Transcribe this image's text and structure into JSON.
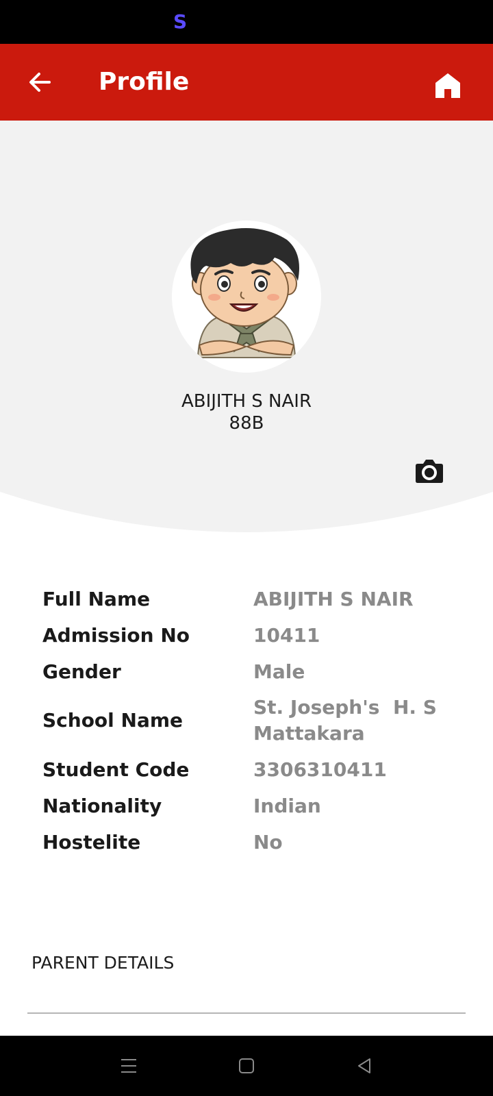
{
  "status_bar": {
    "indicator": "S",
    "indicator_color": "#5a4bff"
  },
  "app_bar": {
    "title": "Profile",
    "background": "#cb1a0d",
    "back_icon": "arrow-left-icon",
    "home_icon": "home-icon"
  },
  "profile": {
    "name": "ABIJITH S NAIR",
    "class": "88B",
    "avatar_icon": "cartoon-boy-avatar",
    "camera_icon": "camera-icon"
  },
  "details": [
    {
      "label": "Full Name",
      "value": "ABIJITH S NAIR"
    },
    {
      "label": "Admission No",
      "value": "10411"
    },
    {
      "label": "Gender",
      "value": "Male"
    },
    {
      "label": "School Name",
      "value": "St. Joseph's  H. S\nMattakara"
    },
    {
      "label": "Student Code",
      "value": "3306310411"
    },
    {
      "label": "Nationality",
      "value": "Indian"
    },
    {
      "label": "Hostelite",
      "value": "No"
    }
  ],
  "parent_section": {
    "title": "PARENT DETAILS"
  },
  "nav_bar": {
    "menu_icon": "menu-icon",
    "home_icon": "square-home-icon",
    "back_icon": "triangle-back-icon"
  }
}
